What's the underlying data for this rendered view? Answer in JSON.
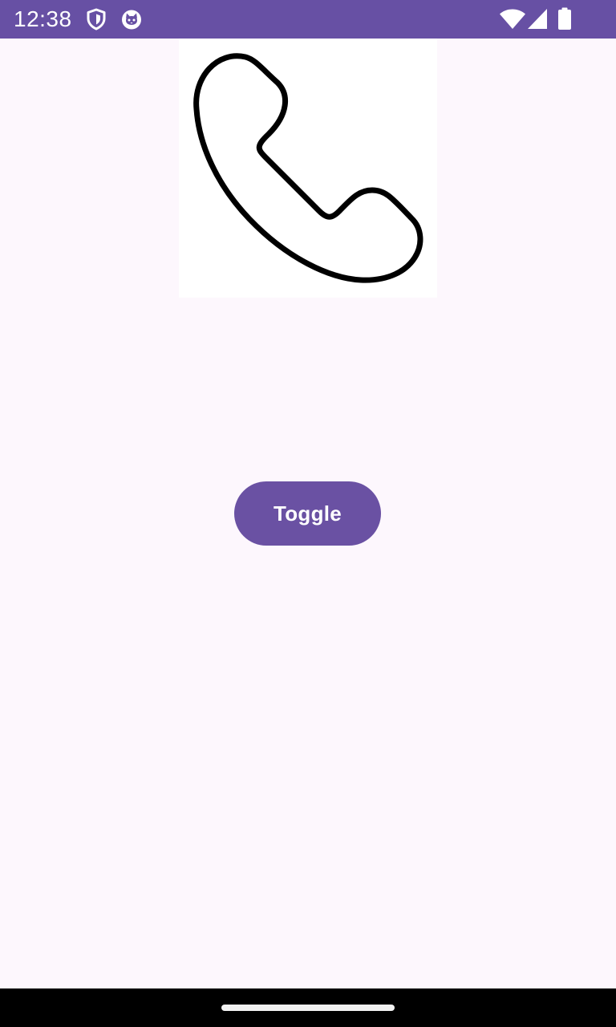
{
  "status_bar": {
    "time": "12:38",
    "background_color": "#6750a4",
    "left_icons": [
      "shield-icon",
      "cat-face-icon"
    ],
    "right_icons": [
      "wifi-icon",
      "cell-signal-icon",
      "battery-icon"
    ]
  },
  "main": {
    "image": {
      "icon": "phone-handset-icon",
      "background_color": "#ffffff"
    },
    "toggle_button": {
      "label": "Toggle",
      "color": "#6a51a3"
    }
  },
  "background_color": "#fdf7fd"
}
